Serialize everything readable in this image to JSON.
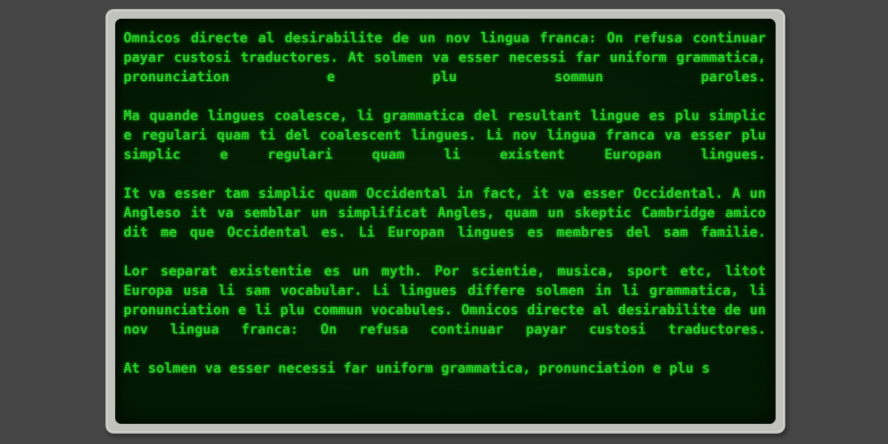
{
  "window": {
    "name": "crt-terminal-window",
    "outer_background": "#454545",
    "bezel_color": "#c2c2bd",
    "screen_background": "#031b03",
    "text_color": "#2ade2a"
  },
  "terminal": {
    "name": "terminal-screen",
    "paragraphs": [
      "Omnicos directe al desirabilite de un nov lingua franca: On refusa continuar payar custosi traductores. At solmen va esser necessi far uniform grammatica, pronunciation e plu sommun paroles.",
      "Ma quande lingues coalesce, li grammatica del resultant lingue es plu simplic e regulari quam ti del coalescent lingues. Li nov lingua franca va esser plu simplic e regulari quam li existent Europan lingues.",
      "It va esser tam simplic quam Occidental in fact, it va esser Occidental. A un Angleso it va semblar un simplificat Angles, quam un skeptic Cambridge amico dit me que Occidental es. Li Europan lingues es membres del sam familie.",
      "Lor separat existentie es un myth. Por scientie, musica, sport etc, litot Europa usa li sam vocabular. Li lingues differe solmen in li grammatica, li pronunciation e li plu commun vocabules. Omnicos directe al desirabilite de un nov lingua franca: On refusa continuar payar custosi traductores.",
      "At solmen va esser necessi far uniform grammatica, pronunciation e plu s"
    ]
  }
}
